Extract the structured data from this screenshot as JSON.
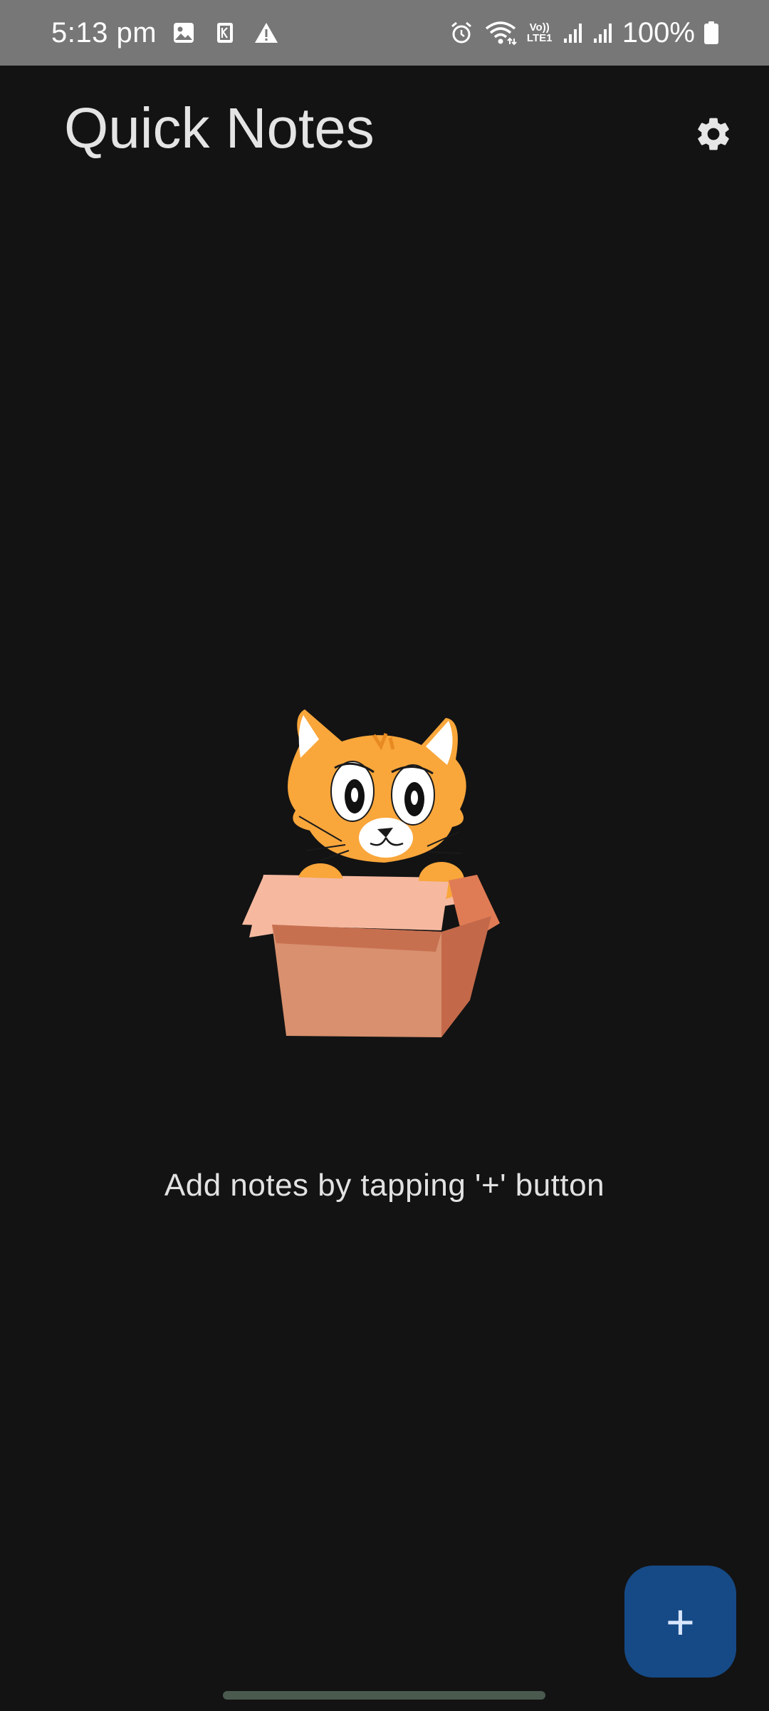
{
  "status_bar": {
    "time": "5:13 pm",
    "network_label": "Vo))\nLTE1",
    "battery_percent": "100%",
    "icons": [
      "image-notification-icon",
      "k-app-notification-icon",
      "warning-icon",
      "alarm-icon",
      "wifi-icon",
      "volte-lte-icon",
      "signal-sim1-icon",
      "signal-sim2-icon",
      "battery-icon"
    ]
  },
  "app_bar": {
    "title": "Quick Notes",
    "settings_icon": "gear-icon"
  },
  "empty_state": {
    "illustration": "cat-in-box",
    "message": "Add notes by tapping '+' button"
  },
  "fab": {
    "label": "+",
    "icon": "plus-icon"
  },
  "colors": {
    "background": "#131313",
    "status_bar": "#777777",
    "title_text": "#e4e4e4",
    "fab_background": "#164a86",
    "fab_foreground": "#d8e6ff",
    "cat_orange": "#f9a63b",
    "box_front": "#d8906e"
  }
}
